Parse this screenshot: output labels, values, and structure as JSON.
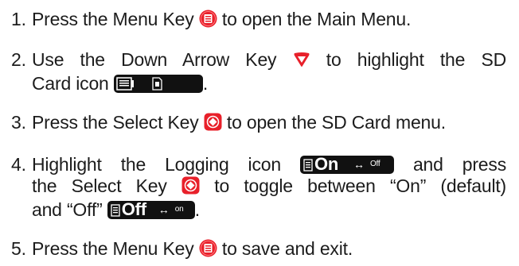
{
  "steps": [
    {
      "number": "1.",
      "line1_a": "Press the Menu Key",
      "line1_b": "to open the Main Menu.",
      "icons": [
        "menu-key-icon"
      ]
    },
    {
      "number": "2.",
      "line1_a": "Use the Down Arrow Key",
      "line1_b": "to highlight the SD",
      "line2_a": "Card icon",
      "line2_b": ".",
      "icons": [
        "down-arrow-key-icon",
        "sd-card-icon"
      ]
    },
    {
      "number": "3.",
      "line1_a": "Press the Select Key",
      "line1_b": "to open the SD Card menu.",
      "icons": [
        "select-key-icon"
      ]
    },
    {
      "number": "4.",
      "line1_a": "Highlight the Logging icon",
      "line1_b": "and press",
      "line2_a": "the Select Key",
      "line2_b": "to toggle between “On” (default)",
      "line3_a": "and “Off”",
      "line3_b": ".",
      "logging_on_label": "On",
      "logging_on_toggle": "Off",
      "logging_off_label": "Off",
      "logging_off_toggle": "on",
      "icons": [
        "logging-on-icon",
        "select-key-icon",
        "logging-off-icon"
      ]
    },
    {
      "number": "5.",
      "line1_a": "Press the Menu Key",
      "line1_b": "to save and exit.",
      "icons": [
        "menu-key-icon"
      ]
    }
  ],
  "colors": {
    "menu_key": "#e8202a",
    "arrow_key": "#e8202a",
    "select_key": "#e8202a",
    "lcd_background": "#111111"
  }
}
